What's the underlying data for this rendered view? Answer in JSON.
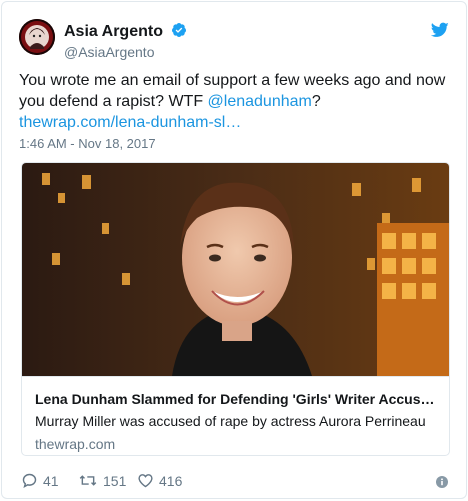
{
  "author": {
    "display_name": "Asia Argento",
    "handle": "@AsiaArgento",
    "verified_icon": "verified-badge-icon",
    "avatar_icon": "avatar"
  },
  "tweet": {
    "text_before": "You wrote me an email of support a few weeks ago and now you defend a rapist? WTF ",
    "mention": "@lenadunham",
    "text_middle": "? ",
    "link": "thewrap.com/lena-dunham-sl…",
    "timestamp": "1:46 AM - Nov 18, 2017"
  },
  "card": {
    "title": "Lena Dunham Slammed for Defending 'Girls' Writer Accused …",
    "description": "Murray Miller was accused of rape by actress Aurora Perrineau",
    "domain": "thewrap.com"
  },
  "actions": {
    "replies": "41",
    "retweets": "151",
    "likes": "416"
  },
  "colors": {
    "link": "#1b95e0",
    "secondary_text": "#657786",
    "border": "#e1e8ed",
    "twitter_blue": "#1da1f2"
  }
}
